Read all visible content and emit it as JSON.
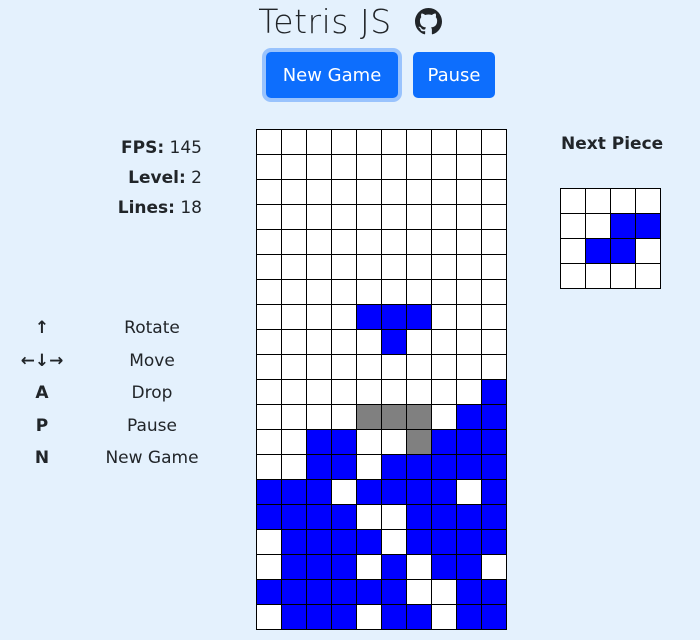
{
  "header": {
    "title": "Tetris JS",
    "github_icon": "github-icon"
  },
  "buttons": {
    "new_game": "New Game",
    "pause": "Pause"
  },
  "stats": {
    "fps_label": "FPS:",
    "fps_value": "145",
    "level_label": "Level:",
    "level_value": "2",
    "lines_label": "Lines:",
    "lines_value": "18"
  },
  "controls": [
    {
      "key": "↑",
      "action": "Rotate"
    },
    {
      "key": "←↓→",
      "action": "Move"
    },
    {
      "key": "A",
      "action": "Drop"
    },
    {
      "key": "P",
      "action": "Pause"
    },
    {
      "key": "N",
      "action": "New Game"
    }
  ],
  "next_piece": {
    "title": "Next Piece",
    "grid": [
      "....",
      "..BB",
      ".BB.",
      "...."
    ]
  },
  "colors": {
    "B": "#0000ff",
    "G": "#808080",
    ".": "#ffffff"
  },
  "board": [
    "..........",
    "..........",
    "..........",
    "..........",
    "..........",
    "..........",
    "..........",
    "....BBB...",
    ".....B....",
    "..........",
    ".........B",
    "....GGG.BB",
    "..BB..GBBB",
    "..BB.BBBBB",
    "BBB.BBBB.B",
    "BBBB..BBBB",
    ".BBBB.BBBB",
    ".BBB.B.BB.",
    "BBBBBB..BB",
    ".BBB.BB.BB"
  ]
}
